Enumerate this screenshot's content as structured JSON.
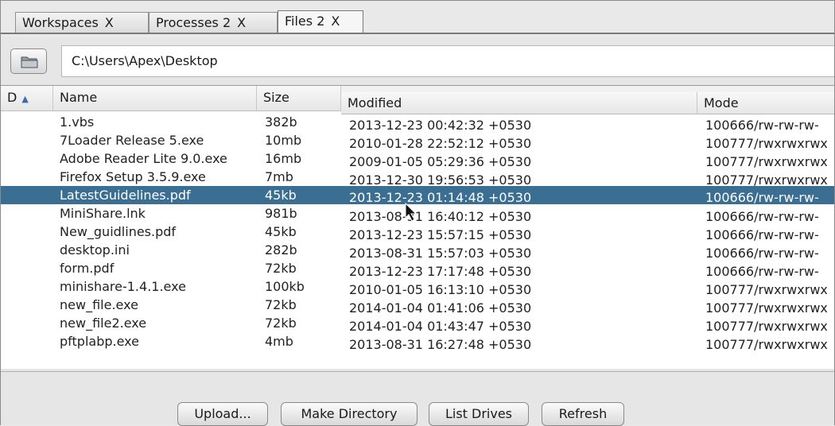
{
  "tabs": [
    {
      "label": "Workspaces",
      "close": "X",
      "active": false
    },
    {
      "label": "Processes 2",
      "close": "X",
      "active": false
    },
    {
      "label": "Files 2",
      "close": "X",
      "active": true
    }
  ],
  "path": {
    "value": "C:\\Users\\Apex\\Desktop",
    "folder_icon": "folder-icon"
  },
  "table": {
    "columns": {
      "d": "D",
      "name": "Name",
      "size": "Size",
      "modified": "Modified",
      "mode": "Mode"
    },
    "sort_indicator": "▲",
    "rows": [
      {
        "name": "1.vbs",
        "size": "382b",
        "modified": "2013-12-23 00:42:32 +0530",
        "mode": "100666/rw-rw-rw-"
      },
      {
        "name": "7Loader Release 5.exe",
        "size": "10mb",
        "modified": "2010-01-28 22:52:12 +0530",
        "mode": "100777/rwxrwxrwx"
      },
      {
        "name": "Adobe Reader Lite 9.0.exe",
        "size": "16mb",
        "modified": "2009-01-05 05:29:36 +0530",
        "mode": "100777/rwxrwxrwx"
      },
      {
        "name": "Firefox Setup 3.5.9.exe",
        "size": "7mb",
        "modified": "2013-12-30 19:56:53 +0530",
        "mode": "100777/rwxrwxrwx"
      },
      {
        "name": "LatestGuidelines.pdf",
        "size": "45kb",
        "modified": "2013-12-23 01:14:48 +0530",
        "mode": "100666/rw-rw-rw-"
      },
      {
        "name": "MiniShare.lnk",
        "size": "981b",
        "modified": "2013-08-31 16:40:12 +0530",
        "mode": "100666/rw-rw-rw-"
      },
      {
        "name": "New_guidlines.pdf",
        "size": "45kb",
        "modified": "2013-12-23 15:57:15 +0530",
        "mode": "100666/rw-rw-rw-"
      },
      {
        "name": "desktop.ini",
        "size": "282b",
        "modified": "2013-08-31 15:57:03 +0530",
        "mode": "100666/rw-rw-rw-"
      },
      {
        "name": "form.pdf",
        "size": "72kb",
        "modified": "2013-12-23 17:17:48 +0530",
        "mode": "100666/rw-rw-rw-"
      },
      {
        "name": "minishare-1.4.1.exe",
        "size": "100kb",
        "modified": "2010-01-05 16:13:10 +0530",
        "mode": "100777/rwxrwxrwx"
      },
      {
        "name": "new_file.exe",
        "size": "72kb",
        "modified": "2014-01-04 01:41:06 +0530",
        "mode": "100777/rwxrwxrwx"
      },
      {
        "name": "new_file2.exe",
        "size": "72kb",
        "modified": "2014-01-04 01:43:47 +0530",
        "mode": "100777/rwxrwxrwx"
      },
      {
        "name": "pftplabp.exe",
        "size": "4mb",
        "modified": "2013-08-31 16:27:48 +0530",
        "mode": "100777/rwxrwxrwx"
      }
    ],
    "selected_row_index": 4
  },
  "buttons": {
    "upload": "Upload...",
    "make_directory": "Make Directory",
    "list_drives": "List Drives",
    "refresh": "Refresh"
  },
  "colors": {
    "selection": "#3a6e92",
    "sort_arrow": "#3e6aa8"
  }
}
